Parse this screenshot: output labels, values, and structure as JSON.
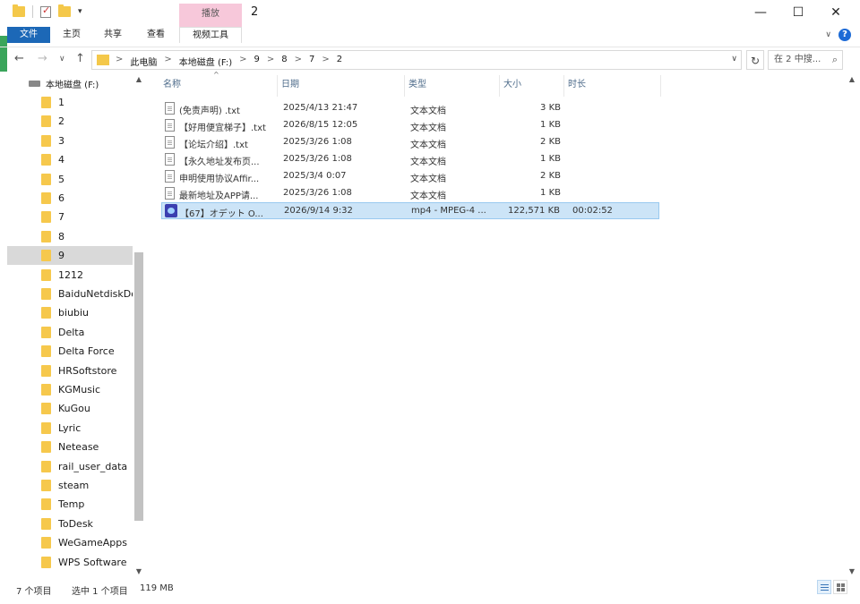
{
  "window": {
    "title": "2",
    "context_tab_label": "播放",
    "controls": {
      "minimize": "—",
      "maximize": "☐",
      "close": "✕"
    }
  },
  "ribbon": {
    "tabs": [
      {
        "label": "文件",
        "active": true
      },
      {
        "label": "主页"
      },
      {
        "label": "共享"
      },
      {
        "label": "查看"
      },
      {
        "label": "视频工具",
        "context": true
      }
    ],
    "collapse_glyph": "∨",
    "help_glyph": "?"
  },
  "address": {
    "back_glyph": "←",
    "forward_glyph": "→",
    "recent_glyph": "∨",
    "up_glyph": "↑",
    "breadcrumbs": [
      "此电脑",
      "本地磁盘 (F:)",
      "9",
      "8",
      "7",
      "2"
    ],
    "crumb_sep": ">",
    "dropdown_glyph": "∨",
    "refresh_glyph": "↻",
    "search_placeholder": "在 2 中搜...",
    "search_glyph": "⌕"
  },
  "sidebar": {
    "drive_label": "本地磁盘 (F:)",
    "items": [
      {
        "label": "1"
      },
      {
        "label": "2"
      },
      {
        "label": "3"
      },
      {
        "label": "4"
      },
      {
        "label": "5"
      },
      {
        "label": "6"
      },
      {
        "label": "7"
      },
      {
        "label": "8"
      },
      {
        "label": "9",
        "selected": true
      },
      {
        "label": "1212"
      },
      {
        "label": "BaiduNetdiskDov"
      },
      {
        "label": "biubiu"
      },
      {
        "label": "Delta"
      },
      {
        "label": "Delta Force"
      },
      {
        "label": "HRSoftstore"
      },
      {
        "label": "KGMusic"
      },
      {
        "label": "KuGou"
      },
      {
        "label": "Lyric"
      },
      {
        "label": "Netease"
      },
      {
        "label": "rail_user_data"
      },
      {
        "label": "steam"
      },
      {
        "label": "Temp"
      },
      {
        "label": "ToDesk"
      },
      {
        "label": "WeGameApps"
      },
      {
        "label": "WPS Software"
      }
    ],
    "scroll_up_glyph": "▲",
    "scroll_down_glyph": "▼"
  },
  "file_list": {
    "sort_glyph": "^",
    "columns": [
      "名称",
      "日期",
      "类型",
      "大小",
      "时长"
    ],
    "rows": [
      {
        "name": "(免责声明) .txt",
        "date": "2025/4/13 21:47",
        "type": "文本文档",
        "size": "3 KB",
        "duration": "",
        "icon": "text-file-icon"
      },
      {
        "name": "【好用便宜梯子】.txt",
        "date": "2026/8/15 12:05",
        "type": "文本文档",
        "size": "1 KB",
        "duration": "",
        "icon": "text-file-icon"
      },
      {
        "name": "【论坛介绍】.txt",
        "date": "2025/3/26 1:08",
        "type": "文本文档",
        "size": "2 KB",
        "duration": "",
        "icon": "text-file-icon"
      },
      {
        "name": "【永久地址发布页...",
        "date": "2025/3/26 1:08",
        "type": "文本文档",
        "size": "1 KB",
        "duration": "",
        "icon": "text-file-icon"
      },
      {
        "name": "申明使用协议Affir...",
        "date": "2025/3/4 0:07",
        "type": "文本文档",
        "size": "2 KB",
        "duration": "",
        "icon": "text-file-icon"
      },
      {
        "name": "最新地址及APP请...",
        "date": "2025/3/26 1:08",
        "type": "文本文档",
        "size": "1 KB",
        "duration": "",
        "icon": "text-file-icon"
      },
      {
        "name": "【67】オデット O...",
        "date": "2026/9/14 9:32",
        "type": "mp4 - MPEG-4 ...",
        "size": "122,571 KB",
        "duration": "00:02:52",
        "icon": "video-file-icon",
        "selected": true
      }
    ]
  },
  "right_scroll": {
    "up_glyph": "▲",
    "down_glyph": "▼"
  },
  "status": {
    "item_count": "7 个项目",
    "selected": "选中 1 个项目",
    "size": "119 MB"
  }
}
